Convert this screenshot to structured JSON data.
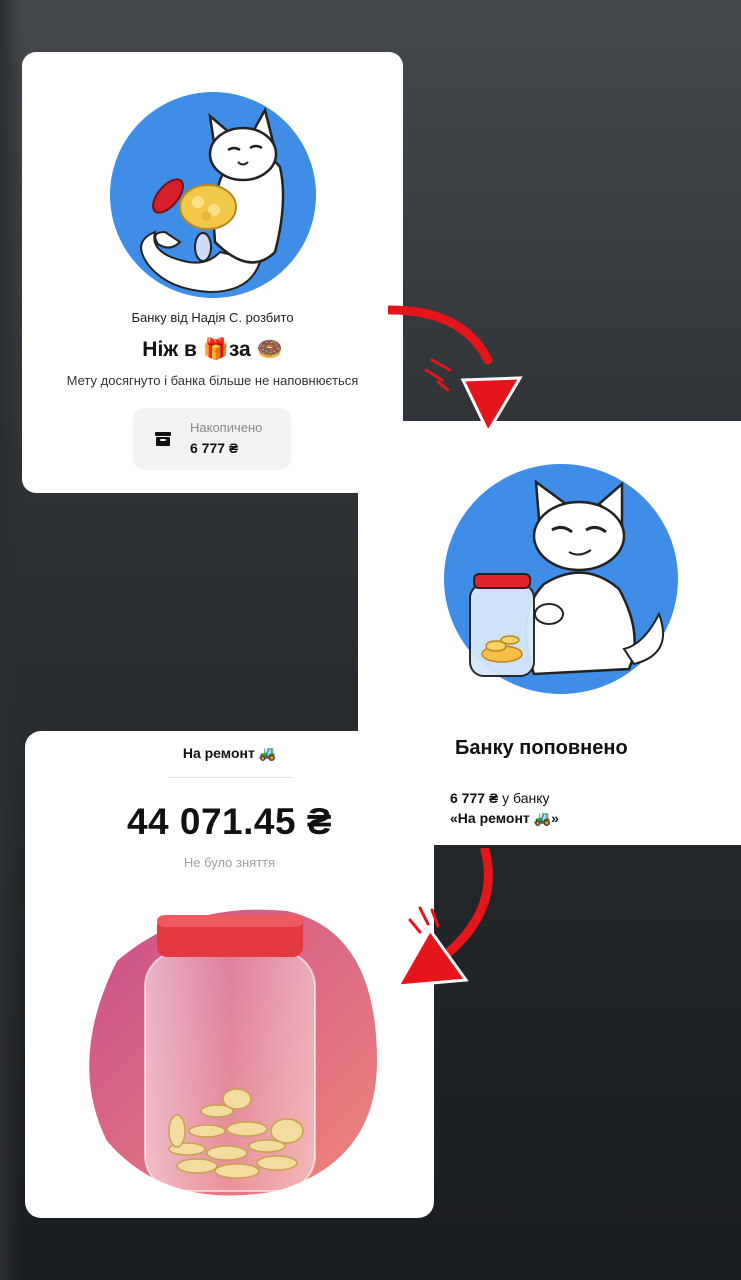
{
  "card1": {
    "subtitle": "Банку від Надія С. розбито",
    "title": "Ніж в 🎁за 🍩",
    "description": "Мету досягнуто і банка більше не наповнюється",
    "saved_label": "Накопичено",
    "saved_value": "6 777 ₴",
    "icons": [
      "cat-with-coin-jar-illustration",
      "archive-icon"
    ]
  },
  "card2": {
    "title": "Банку поповнено",
    "amount": "6 777 ₴",
    "amount_suffix": " у банку",
    "jar_name": "«На ремонт 🚜»",
    "icons": [
      "cat-holding-jar-illustration",
      "honey-jar-icon"
    ]
  },
  "card3": {
    "title": "На ремонт 🚜",
    "balance": "44 071.45 ₴",
    "note": "Не було зняття",
    "icons": [
      "coin-jar-illustration"
    ]
  },
  "colors": {
    "accent_red": "#e4161b",
    "illustration_blue": "#3f8de6",
    "jar_gradient_from": "#c94f8c",
    "jar_gradient_to": "#f0857a"
  }
}
